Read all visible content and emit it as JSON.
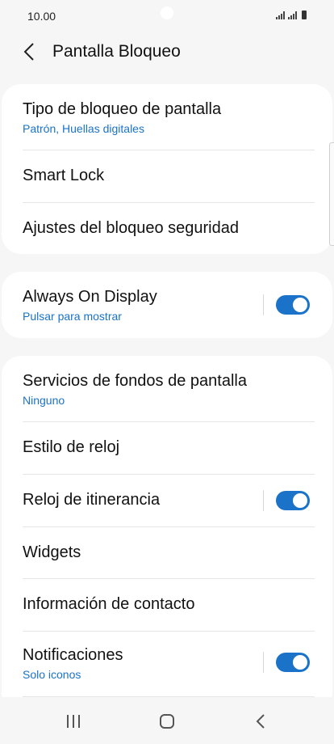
{
  "status_bar": {
    "time": "10.00"
  },
  "header": {
    "title": "Pantalla Bloqueo"
  },
  "sections": {
    "lock_type": {
      "label": "Tipo de bloqueo de pantalla",
      "sub": "Patrón, Huellas digitales"
    },
    "smart_lock": {
      "label": "Smart Lock"
    },
    "secure_lock_settings": {
      "label": "Ajustes del bloqueo seguridad"
    },
    "always_on_display": {
      "label": "Always On Display",
      "sub": "Pulsar para mostrar",
      "toggle_on": true
    },
    "wallpaper_services": {
      "label": "Servicios de fondos de pantalla",
      "sub": "Ninguno"
    },
    "clock_style": {
      "label": "Estilo de reloj"
    },
    "roaming_clock": {
      "label": "Reloj de itinerancia",
      "toggle_on": true
    },
    "widgets": {
      "label": "Widgets"
    },
    "contact_info": {
      "label": "Información de contacto"
    },
    "notifications": {
      "label": "Notificaciones",
      "sub": "Solo iconos",
      "toggle_on": true
    }
  },
  "colors": {
    "accent": "#1a73c9",
    "background": "#f6f6f6",
    "card": "#ffffff"
  },
  "icons": {
    "back": "chevron-left-icon",
    "recents": "recent-apps-icon",
    "home": "home-icon",
    "nav_back": "back-nav-icon"
  }
}
